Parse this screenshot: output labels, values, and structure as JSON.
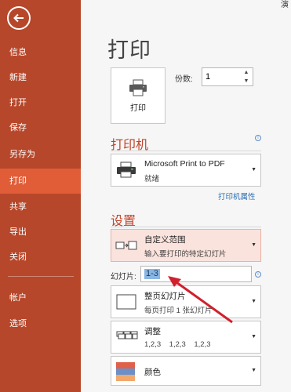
{
  "sidebar": {
    "items": [
      {
        "label": "信息"
      },
      {
        "label": "新建"
      },
      {
        "label": "打开"
      },
      {
        "label": "保存"
      },
      {
        "label": "另存为"
      },
      {
        "label": "打印"
      },
      {
        "label": "共享"
      },
      {
        "label": "导出"
      },
      {
        "label": "关闭"
      },
      {
        "label": "帐户"
      },
      {
        "label": "选项"
      }
    ],
    "active_index": 5
  },
  "main": {
    "corner_char": "演",
    "title": "打印",
    "print_button_label": "打印",
    "copies": {
      "label": "份数:",
      "value": "1"
    },
    "printer_section": {
      "title": "打印机",
      "printer_name": "Microsoft Print to PDF",
      "printer_status": "就绪",
      "properties_link": "打印机属性"
    },
    "settings_section": {
      "title": "设置",
      "range": {
        "title": "自定义范围",
        "subtitle": "输入要打印的特定幻灯片"
      },
      "slides": {
        "label": "幻灯片:",
        "value": "1-3"
      },
      "layout": {
        "title": "整页幻灯片",
        "subtitle": "每页打印 1 张幻灯片"
      },
      "collate": {
        "title": "调整",
        "subtitle": "1,2,3    1,2,3    1,2,3"
      },
      "color": {
        "title": "颜色"
      }
    }
  },
  "colors": {
    "sidebar_bg": "#b7472a",
    "sidebar_active": "#e05d38",
    "section_title": "#c0442a",
    "link": "#2b6cb0",
    "highlight_bg": "#fbe3dd",
    "annotation_arrow": "#d0202e"
  },
  "icons": [
    "back-arrow-icon",
    "printer-icon",
    "pdf-printer-icon",
    "info-icon",
    "custom-range-icon",
    "full-page-slide-icon",
    "collate-icon",
    "color-swatch-icon",
    "chevron-down-icon",
    "annotation-arrow"
  ]
}
